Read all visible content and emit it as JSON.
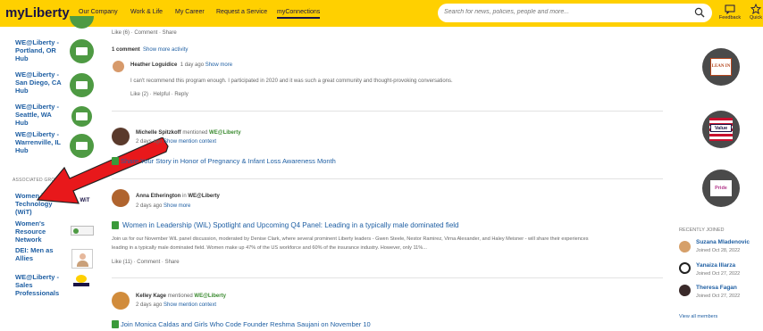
{
  "header": {
    "logo": "myLiberty",
    "nav": [
      "Our Company",
      "Work & Life",
      "My Career",
      "Request a Service",
      "myConnections"
    ],
    "search_placeholder": "Search for news, policies, people and more...",
    "feedback_label": "Feedback",
    "quick_label": "Quick"
  },
  "sidebar": {
    "hubs": [
      {
        "label": "WE@Liberty - Portland, OR Hub"
      },
      {
        "label": "WE@Liberty - San Diego, CA Hub"
      },
      {
        "label": "WE@Liberty - Seattle, WA Hub"
      },
      {
        "label": "WE@Liberty - Warrenville, IL Hub"
      }
    ],
    "section_label": "ASSOCIATED GROUPS",
    "groups": [
      {
        "label": "Women in Technology (WiT)",
        "logo": "WiT"
      },
      {
        "label": "Women's Resource Network"
      },
      {
        "label": "DEI: Men as Allies"
      },
      {
        "label": "WE@Liberty - Sales Professionals"
      }
    ]
  },
  "feed": {
    "top_actions": "Like (6) · Comment · Share",
    "comment_count": "1 comment",
    "show_more_activity": "Show more activity",
    "comment": {
      "author": "Heather Loguidice",
      "time": "1 day ago",
      "show_more": "Show more",
      "text": "I can't recommend this program enough. I participated in 2020 and it was such a great community and thought-provoking conversations.",
      "actions": "Like (2) · Helpful · Reply"
    },
    "post1": {
      "author": "Michelle Spitzkoff",
      "verb": "mentioned",
      "group": "WE@Liberty",
      "time": "2 days ago",
      "context": "Show mention context",
      "title": "Share Your Story in Honor of Pregnancy & Infant Loss Awareness Month"
    },
    "post2": {
      "author": "Anna Etherington",
      "verb": "in",
      "group": "WE@Liberty",
      "time": "2 days ago",
      "show_more": "Show more",
      "title": "Women in Leadership (WiL) Spotlight and Upcoming Q4 Panel: Leading in a typically male dominated field",
      "body1": "Join us for our November WiL panel discussion, moderated by Denise Clark, where several prominent Liberty leaders - Gwen Steele, Nestor Ramirez, Virna Alexander,  and Haley Meisner - will share their experiences",
      "body2": "leading in a typically male dominated field.  Women make up 47% of the US workforce and 60% of the insurance industry. However, only 11%...",
      "actions": "Like (11) · Comment · Share"
    },
    "post3": {
      "author": "Kelley Kage",
      "verb": "mentioned",
      "group": "WE@Liberty",
      "time": "2 days ago",
      "context": "Show mention context",
      "title": "Join Monica Caldas and Girls Who Code Founder Reshma Saujani on November 10"
    }
  },
  "right": {
    "badges": [
      {
        "label": "LEAN IN"
      },
      {
        "label": "Value"
      },
      {
        "label": "Pride"
      }
    ],
    "recently_joined_label": "RECENTLY JOINED",
    "members": [
      {
        "name": "Suzana Mladenovic",
        "joined": "Joined Oct 28, 2022"
      },
      {
        "name": "Yanaiza Illarza",
        "joined": "Joined Oct 27, 2022"
      },
      {
        "name": "Theresa Fagan",
        "joined": "Joined Oct 27, 2022"
      }
    ],
    "view_all": "View all members"
  },
  "colors": {
    "brand_yellow": "#ffd000",
    "navy": "#1a1446",
    "link": "#1f5fa3",
    "green": "#4e9a43",
    "arrow": "#e8181b"
  }
}
